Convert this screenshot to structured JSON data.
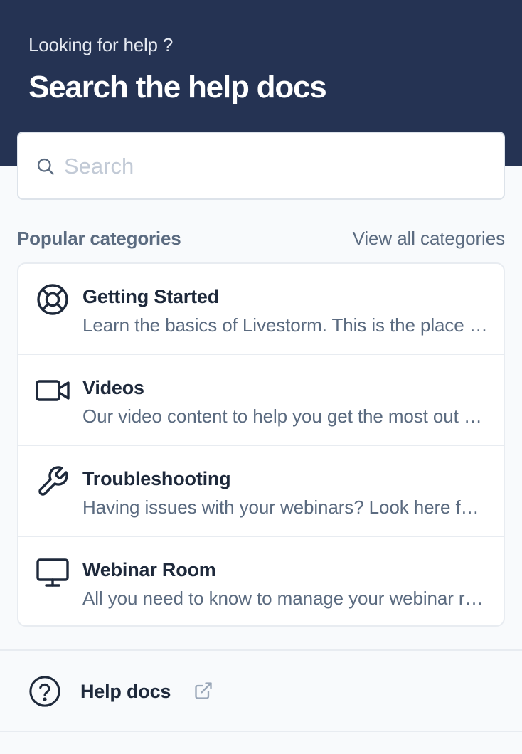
{
  "header": {
    "eyebrow": "Looking for help ?",
    "title": "Search the help docs"
  },
  "search": {
    "placeholder": "Search",
    "value": "",
    "icon": "search-icon"
  },
  "categories_section": {
    "title": "Popular categories",
    "view_all_label": "View all categories"
  },
  "categories": [
    {
      "icon": "lifebuoy-icon",
      "title": "Getting Started",
      "description": "Learn the basics of Livestorm. This is the place to get started."
    },
    {
      "icon": "video-camera-icon",
      "title": "Videos",
      "description": "Our video content to help you get the most out of Livestorm."
    },
    {
      "icon": "wrench-icon",
      "title": "Troubleshooting",
      "description": "Having issues with your webinars? Look here for answers."
    },
    {
      "icon": "monitor-icon",
      "title": "Webinar Room",
      "description": "All you need to know to manage your webinar room."
    }
  ],
  "footer": {
    "help_docs_label": "Help docs",
    "icon": "question-circle-icon",
    "external_icon": "external-link-icon"
  },
  "colors": {
    "header_bg": "#253353",
    "page_bg": "#f8fafc",
    "text_primary": "#1e293b",
    "text_secondary": "#5b6b80",
    "border": "#e8ecf1"
  }
}
